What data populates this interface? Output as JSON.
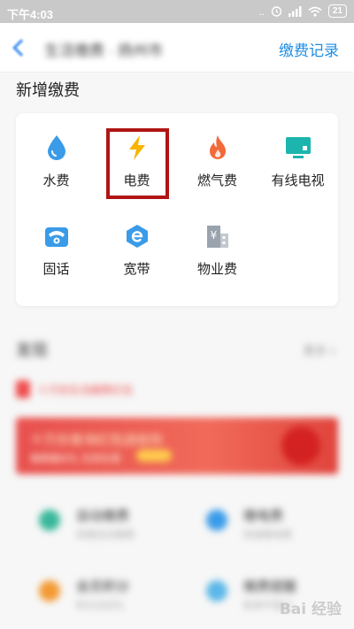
{
  "status_bar": {
    "time": "下午4:03",
    "signal_text": "..",
    "battery": "21"
  },
  "header": {
    "title": "生活缴费 · 扬州市",
    "records_label": "缴费记录"
  },
  "add_payment": {
    "title": "新增缴费",
    "items": [
      {
        "label": "水费",
        "icon": "water-drop-icon",
        "color": "#3a9be8"
      },
      {
        "label": "电费",
        "icon": "lightning-icon",
        "color": "#f7b500"
      },
      {
        "label": "燃气费",
        "icon": "flame-icon",
        "color": "#f26a3a"
      },
      {
        "label": "有线电视",
        "icon": "tv-icon",
        "color": "#1bb5ad"
      },
      {
        "label": "固话",
        "icon": "telephone-icon",
        "color": "#3a9be8"
      },
      {
        "label": "宽带",
        "icon": "broadband-icon",
        "color": "#3a9be8"
      },
      {
        "label": "物业费",
        "icon": "property-building-icon",
        "color": "#9aa3ad"
      }
    ]
  },
  "blurred_section": {
    "title": "发现",
    "more": "更多 >",
    "tip": "十万份生活缴费红包",
    "banner_title": "十万份查询红包送给你",
    "banner_sub": "缴费赢好礼 先到先得",
    "services": [
      {
        "name": "自动缴费",
        "sub": "到期自动缴费",
        "color": "#39b79a"
      },
      {
        "name": "缴电费",
        "sub": "快速缴电费",
        "color": "#3a9be8"
      },
      {
        "name": "会员积分",
        "sub": "积分兑好礼",
        "color": "#f39a33"
      },
      {
        "name": "缴费提醒",
        "sub": "账单不错过",
        "color": "#5bb7e8"
      }
    ]
  },
  "watermark": "Bai 经验"
}
